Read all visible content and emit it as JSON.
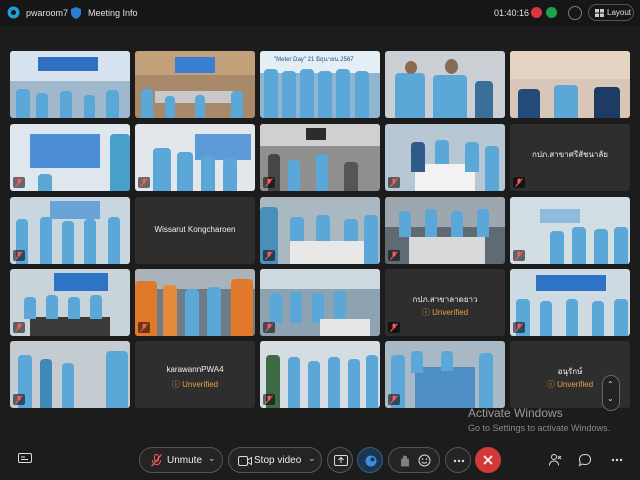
{
  "topbar": {
    "host": "pwaroom7",
    "meeting_info": "Meeting Info",
    "timer": "01:40:16",
    "layout_label": "Layout"
  },
  "tiles": {
    "t20": {
      "name": "กปภ.สาขาศรีสัชนาลัย"
    },
    "t31": {
      "name": "Wissarut Kongcharoen"
    },
    "t43": {
      "name": "กปภ.สาขาลาดยาว",
      "status": "Unverified"
    },
    "t51": {
      "name": "karawannPWA4",
      "status": "Unverified"
    },
    "t54": {
      "name": "อนุรักษ์",
      "status": "Unverified"
    },
    "t02_banner": "\"Meter Day\"  21 มิถุนายน 2567"
  },
  "toolbar": {
    "unmute_label": "Unmute",
    "stop_video_label": "Stop video"
  },
  "watermark": {
    "title": "Activate Windows",
    "subtitle": "Go to Settings to activate Windows."
  },
  "colors": {
    "background": "#1c1c1c",
    "leave_red": "#d23a3a",
    "unverified_orange": "#e8a33c",
    "staff_shirt_blue": "#5aa7d8"
  }
}
